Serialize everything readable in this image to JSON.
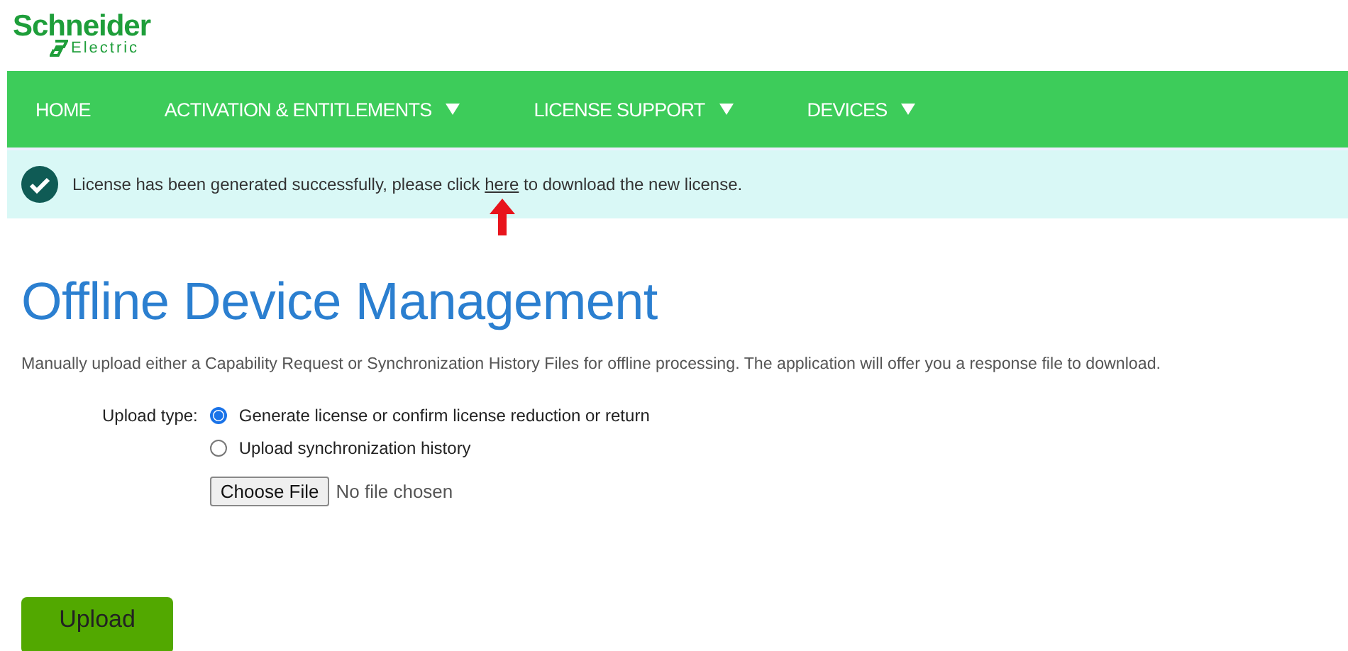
{
  "logo": {
    "name": "Schneider",
    "sub": "Electric"
  },
  "nav": [
    {
      "label": "HOME",
      "has_dropdown": false
    },
    {
      "label": "ACTIVATION & ENTITLEMENTS",
      "has_dropdown": true
    },
    {
      "label": "LICENSE SUPPORT",
      "has_dropdown": true
    },
    {
      "label": "DEVICES",
      "has_dropdown": true
    }
  ],
  "notice": {
    "before": "License has been generated successfully, please click",
    "link": "here",
    "after": "to download the new license.",
    "annotated": true
  },
  "title": "Offline Device Management",
  "description": "Manually upload either a Capability Request or Synchronization History Files for offline processing. The application will offer you a response file to download.",
  "upload_type": {
    "label": "Upload type:",
    "options": [
      {
        "label": "Generate license or confirm license reduction or return",
        "selected": true
      },
      {
        "label": "Upload synchronization history",
        "selected": false
      }
    ]
  },
  "file": {
    "button": "Choose File",
    "status": "No file chosen"
  },
  "submit": "Upload"
}
